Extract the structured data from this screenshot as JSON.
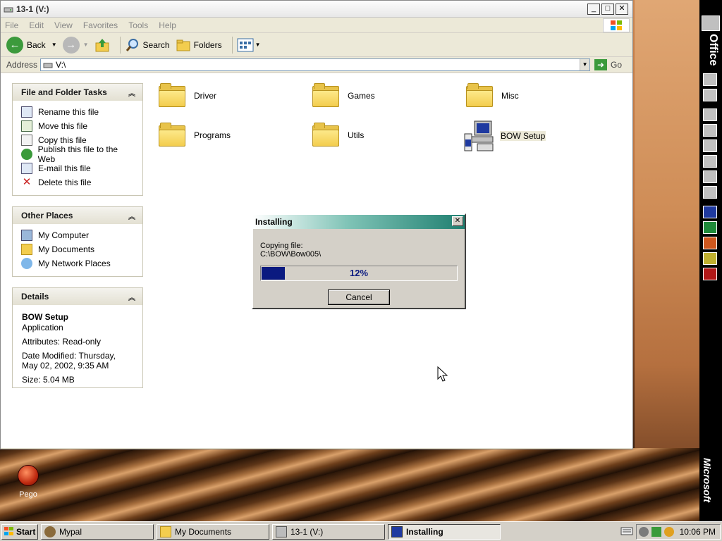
{
  "window": {
    "title": "13-1 (V:)",
    "menu": [
      "File",
      "Edit",
      "View",
      "Favorites",
      "Tools",
      "Help"
    ],
    "toolbar": {
      "back": "Back",
      "search": "Search",
      "folders": "Folders"
    },
    "address": {
      "label": "Address",
      "value": "V:\\",
      "go": "Go"
    }
  },
  "tasks": {
    "title": "File and Folder Tasks",
    "items": [
      "Rename this file",
      "Move this file",
      "Copy this file",
      "Publish this file to the Web",
      "E-mail this file",
      "Delete this file"
    ]
  },
  "other_places": {
    "title": "Other Places",
    "items": [
      "My Computer",
      "My Documents",
      "My Network Places"
    ]
  },
  "details": {
    "title": "Details",
    "name": "BOW Setup",
    "type": "Application",
    "attributes": "Attributes: Read-only",
    "modified": "Date Modified: Thursday, May 02, 2002, 9:35 AM",
    "size": "Size: 5.04 MB"
  },
  "files": [
    "Driver",
    "Games",
    "Misc",
    "Programs",
    "Utils",
    "BOW Setup"
  ],
  "dialog": {
    "title": "Installing",
    "line1": "Copying file:",
    "line2": "C:\\BOW\\Bow005\\",
    "progress_percent": 12,
    "progress_text": "12%",
    "cancel": "Cancel"
  },
  "officebar": {
    "label": "Office",
    "brand": "Microsoft"
  },
  "desktop": {
    "icon_label": "Pego"
  },
  "taskbar": {
    "start": "Start",
    "tasks": [
      "Mypal",
      "My Documents",
      "13-1 (V:)",
      "Installing"
    ],
    "clock": "10:06 PM"
  },
  "colors": {
    "progress": "#0a1a80",
    "dialog_title": "#1f7f70",
    "folder": "#f3cd4e"
  }
}
